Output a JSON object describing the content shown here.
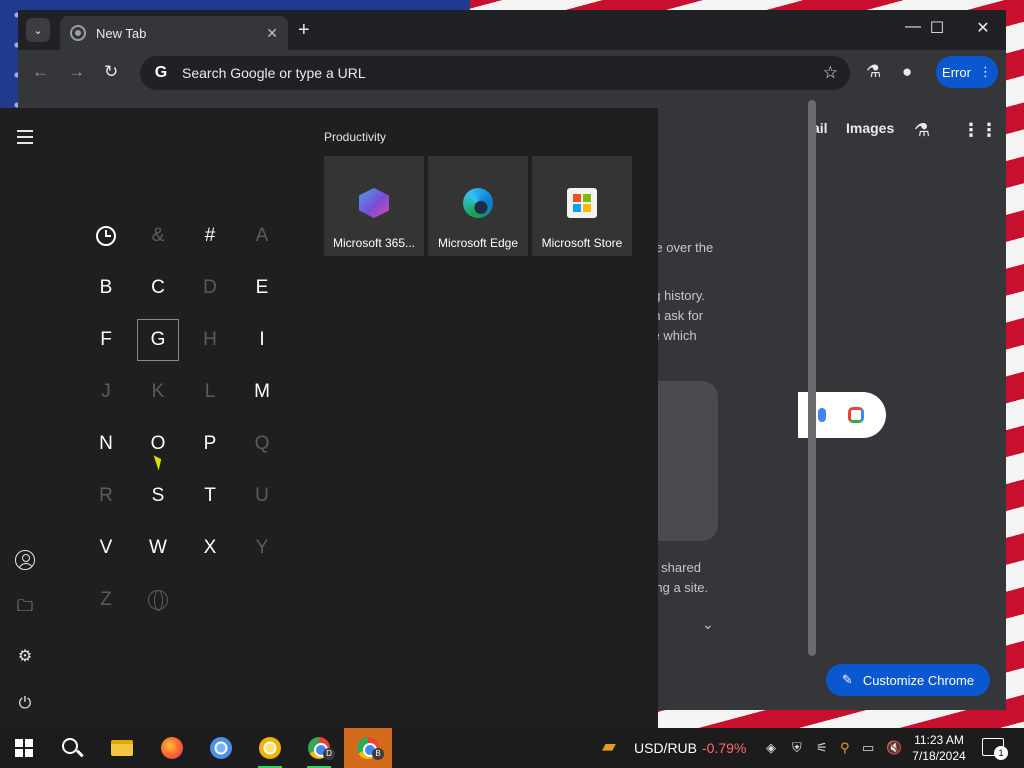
{
  "chrome": {
    "tab_title": "New Tab",
    "new_tab_symbol": "+",
    "tab_close_symbol": "✕",
    "tab_search_symbol": "⌄",
    "controls": {
      "minimize": "—",
      "maximize": "☐",
      "close": "✕"
    },
    "nav": {
      "back": "←",
      "forward": "→",
      "reload": "↻"
    },
    "omnibox_g": "G",
    "omnibox_placeholder": "Search Google or type a URL",
    "star_symbol": "☆",
    "labs_symbol": "⚗",
    "profile_symbol": "●",
    "error_label": "Error",
    "menu_symbol": "⋮",
    "accent": "#0b57d0"
  },
  "ntp": {
    "gmail_partial": "ail",
    "images_label": "Images",
    "text_partials": [
      "ice over the",
      "ng history.",
      "an ask for",
      "se which",
      "re shared",
      "iting a site."
    ],
    "expand_symbol": "⌄",
    "customize_label": "Customize Chrome",
    "customize_symbol": "✎"
  },
  "start_menu": {
    "rail": {
      "settings_symbol": "⚙",
      "power_symbol": "⏻",
      "documents_symbol": "🗀"
    },
    "letters": [
      {
        "label": "",
        "kind": "recent-clock",
        "enabled": true
      },
      {
        "label": "&",
        "enabled": false
      },
      {
        "label": "#",
        "enabled": true
      },
      {
        "label": "A",
        "enabled": false
      },
      {
        "label": "B",
        "enabled": true
      },
      {
        "label": "C",
        "enabled": true
      },
      {
        "label": "D",
        "enabled": false
      },
      {
        "label": "E",
        "enabled": true
      },
      {
        "label": "F",
        "enabled": true
      },
      {
        "label": "G",
        "enabled": true,
        "highlighted": true
      },
      {
        "label": "H",
        "enabled": false
      },
      {
        "label": "I",
        "enabled": true
      },
      {
        "label": "J",
        "enabled": false
      },
      {
        "label": "K",
        "enabled": false
      },
      {
        "label": "L",
        "enabled": false
      },
      {
        "label": "M",
        "enabled": true
      },
      {
        "label": "N",
        "enabled": true
      },
      {
        "label": "O",
        "enabled": true
      },
      {
        "label": "P",
        "enabled": true
      },
      {
        "label": "Q",
        "enabled": false
      },
      {
        "label": "R",
        "enabled": false
      },
      {
        "label": "S",
        "enabled": true
      },
      {
        "label": "T",
        "enabled": true
      },
      {
        "label": "U",
        "enabled": false
      },
      {
        "label": "V",
        "enabled": true
      },
      {
        "label": "W",
        "enabled": true
      },
      {
        "label": "X",
        "enabled": true
      },
      {
        "label": "Y",
        "enabled": false
      },
      {
        "label": "Z",
        "enabled": false
      },
      {
        "label": "",
        "kind": "globe",
        "enabled": false
      }
    ],
    "productivity_title": "Productivity",
    "tiles": [
      {
        "label": "Microsoft 365...",
        "icon": "m365-icon"
      },
      {
        "label": "Microsoft Edge",
        "icon": "edge-icon"
      },
      {
        "label": "Microsoft Store",
        "icon": "store-icon"
      }
    ]
  },
  "taskbar": {
    "currency_pair": "USD/RUB",
    "currency_change": "-0.79%",
    "currency_change_color": "#ff6b6b",
    "time": "11:23 AM",
    "date": "7/18/2024",
    "notification_count": "1",
    "active_badge": "B",
    "chrome_badge": "D"
  }
}
